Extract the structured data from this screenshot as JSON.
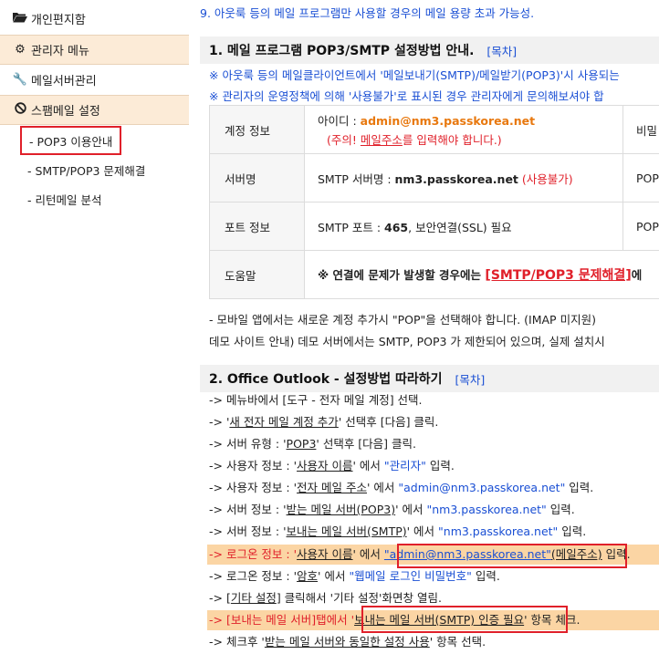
{
  "sidebar": {
    "items": [
      {
        "label": "개인편지함",
        "icon": "folder-open-icon"
      },
      {
        "label": "관리자 메뉴",
        "icon": "gear-icon"
      },
      {
        "label": "메일서버관리",
        "icon": "wrench-icon"
      },
      {
        "label": "스팸메일 설정",
        "icon": "ban-icon"
      }
    ],
    "subitems": [
      "- POP3 이용안내",
      "- SMTP/POP3 문제해결",
      "- 리턴메일 분석"
    ]
  },
  "main": {
    "top_note": "9. 아웃룩 등의 메일 프로그램만 사용할 경우의 메일 용량 초과 가능성.",
    "section1": {
      "title": "1. 메일 프로그램 POP3/SMTP 설정방법 안내.",
      "toc": "[목차]",
      "note1": "※ 아웃룩 등의 메일클라이언트에서 '메일보내기(SMTP)/메일받기(POP3)'시 사용되는",
      "note2": "※ 관리자의 운영정책에 의해 '사용불가'로 표시된 경우 관리자에게 문의해보셔야 합",
      "table": {
        "account_label": "계정 정보",
        "id_prefix": "아이디 : ",
        "id_value": "admin@nm3.passkorea.net",
        "caution_open": "(주의! ",
        "caution_u": "메일주소",
        "caution_rest": "를 입력해야 합니다.)",
        "col3_row1": "비밀",
        "server_label": "서버명",
        "smtp_prefix": "SMTP 서버명 : ",
        "smtp_value": "nm3.passkorea.net",
        "smtp_unavail": " (사용불가)",
        "col3_row2": "POP",
        "port_label": "포트 정보",
        "port_prefix": "SMTP 포트 : ",
        "port_value": "465",
        "port_rest": ", 보안연결(SSL) 필요",
        "col3_row3": "POP",
        "help_label": "도움말",
        "help_prefix": "※ 연결에 문제가 발생할 경우에는 ",
        "help_link": "[SMTP/POP3 문제해결]",
        "help_suffix": "에"
      },
      "mobile_note": "- 모바일 앱에서는 새로운 계정 추가시 \"POP\"을 선택해야 합니다. (IMAP 미지원)",
      "demo_note": "데모 사이트 안내) 데모 서버에서는 SMTP, POP3 가 제한되어 있으며, 실제 설치시"
    },
    "section2": {
      "title": "2. Office Outlook - 설정방법 따라하기",
      "toc": "[목차]",
      "steps": {
        "s1": "-> 메뉴바에서 [도구 - 전자 메일 계정] 선택.",
        "s2_a": "-> '",
        "s2_u": "새 전자 메일 계정 추가",
        "s2_b": "' 선택후 [다음] 클릭.",
        "s3_a": "-> 서버 유형 : '",
        "s3_u": "POP3",
        "s3_b": "' 선택후 [다음] 클릭.",
        "s4_a": "-> 사용자 정보 : '",
        "s4_u": "사용자 이름",
        "s4_b": "' 에서 ",
        "s4_v": "\"관리자\"",
        "s4_c": " 입력.",
        "s5_a": "-> 사용자 정보 : '",
        "s5_u": "전자 메일 주소",
        "s5_b": "' 에서 ",
        "s5_v": "\"admin@nm3.passkorea.net\"",
        "s5_c": " 입력.",
        "s6_a": "-> 서버 정보 : '",
        "s6_u": "받는 메일 서버(POP3)",
        "s6_b": "' 에서 ",
        "s6_v": "\"nm3.passkorea.net\"",
        "s6_c": " 입력.",
        "s7_a": "-> 서버 정보 : '",
        "s7_u": "보내는 메일 서버(SMTP)",
        "s7_b": "' 에서 ",
        "s7_v": "\"nm3.passkorea.net\"",
        "s7_c": " 입력.",
        "s8_a": "-> 로그온 정보 : '",
        "s8_u": "사용자 이름",
        "s8_b": "' 에서 ",
        "s8_v": "\"admin@nm3.passkorea.net\"",
        "s8_p": "(메일주소)",
        "s8_c": " 입력.",
        "s9_a": "-> 로그온 정보 : '",
        "s9_u": "암호",
        "s9_b": "' 에서 ",
        "s9_v": "\"웹메일 로그인 비밀번호\"",
        "s9_c": " 입력.",
        "s10_a": "-> [",
        "s10_u": "기타 설정",
        "s10_b": "] 클릭해서 '기타 설정'화면창 열림.",
        "s11_a": "-> [보내는 메일 서버]탭에서 '",
        "s11_u": "보내는 메일 서버(SMTP) 인증 필요",
        "s11_b": "' 항목 체크.",
        "s12_a": "-> 체크후 '",
        "s12_u": "받는 메일 서버와 동일한 설정 사용",
        "s12_b": "' 항목 선택."
      }
    }
  }
}
